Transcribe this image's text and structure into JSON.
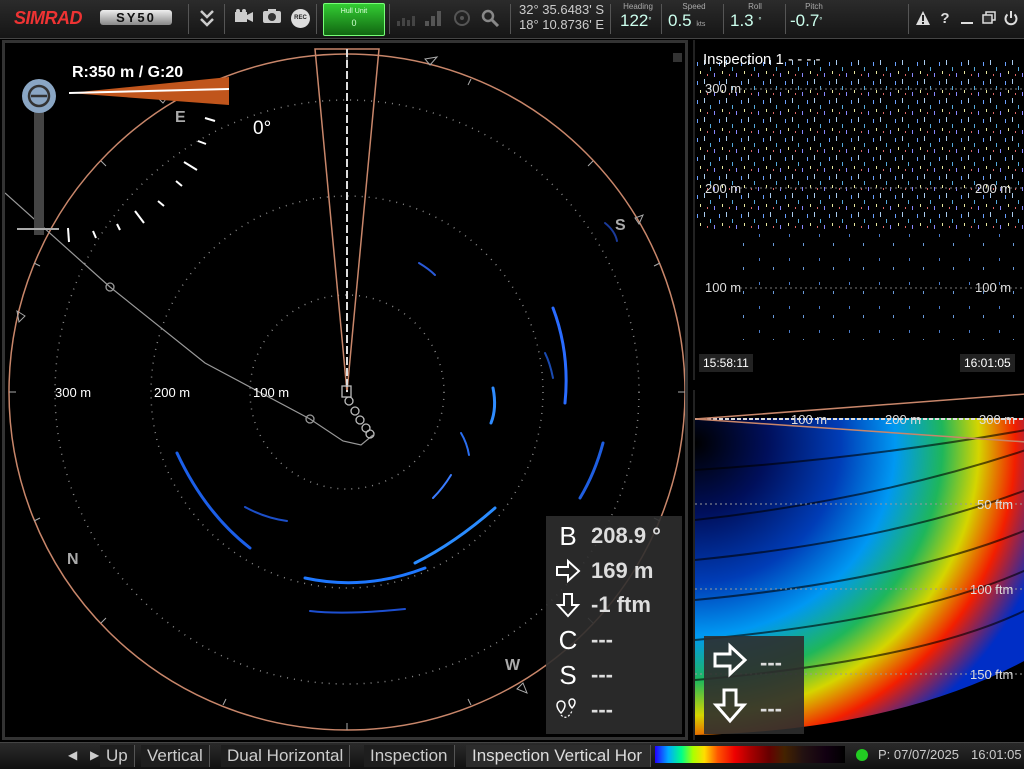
{
  "topbar": {
    "brand": "SIMRAD",
    "model": "SY50",
    "hull_unit_label": "Hull Unit",
    "hull_unit_value": "0",
    "lat": "32° 35.6483' S",
    "lon": "18° 10.8736' E",
    "heading_label": "Heading",
    "heading_value": "122",
    "speed_label": "Speed",
    "speed_value": "0.5",
    "speed_unit": "kts",
    "roll_label": "Roll",
    "roll_value": "1.3",
    "pitch_label": "Pitch",
    "pitch_value": "-0.7",
    "icons": [
      "chevrons-down-icon",
      "camera-icon",
      "photo-icon",
      "rec-icon",
      "bars-icon",
      "signal-icon",
      "target-icon",
      "magnifier-icon",
      "warning-icon",
      "help-icon",
      "minimize-icon",
      "restore-icon",
      "power-icon"
    ],
    "rec_label": "REC"
  },
  "ppi": {
    "range_gain": "R:350 m  / G:20",
    "tilt_label": "0°",
    "ring_labels": [
      "300 m",
      "200 m",
      "100 m"
    ],
    "compass": {
      "e": "E",
      "s": "S",
      "n": "N",
      "w": "W"
    }
  },
  "info_panel": {
    "bearing_icon": "B",
    "bearing": "208.9 °",
    "range": "169 m",
    "depth": "-1 ftm",
    "c_icon": "C",
    "c_value": "---",
    "s_icon": "S",
    "s_value": "---",
    "marker_value": "---"
  },
  "inspection_top": {
    "title": "Inspection 1 - - - -",
    "depths_left": [
      "300 m",
      "200 m",
      "100 m"
    ],
    "depths_right": [
      "200 m",
      "200 m",
      "100 m"
    ],
    "time_start": "15:58:11",
    "time_end": "16:01:05"
  },
  "inspection_bottom": {
    "range_ticks": [
      "100 m",
      "200 m",
      "300 m"
    ],
    "depth_labels": [
      "50 ftm",
      "100 ftm",
      "150 ftm"
    ],
    "range_value": "---",
    "depth_value": "---"
  },
  "bottombar": {
    "tabs": [
      "Up",
      "Vertical",
      "Dual Horizontal",
      "Inspection",
      "Inspection Vertical Hor"
    ],
    "date": "P: 07/07/2025",
    "time": "16:01:05"
  },
  "colors": {
    "accent": "#c86a3a",
    "hull_green": "#33cc33",
    "brand_red": "#e33333"
  }
}
